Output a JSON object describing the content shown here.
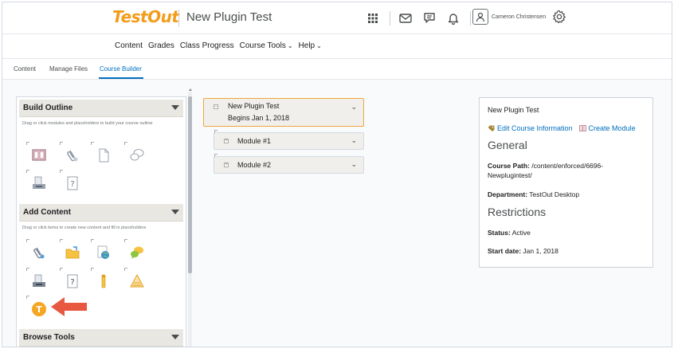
{
  "header": {
    "logo": "TestOut",
    "course_title": "New Plugin Test",
    "user_name": "Cameron Christensen",
    "icons": [
      "grid-icon",
      "mail-icon",
      "chat-icon",
      "bell-icon",
      "user-avatar-icon",
      "gear-icon"
    ]
  },
  "nav": {
    "items": [
      "Content",
      "Grades",
      "Class Progress",
      "Course Tools",
      "Help"
    ]
  },
  "tabs": {
    "items": [
      "Content",
      "Manage Files",
      "Course Builder"
    ],
    "active": "Course Builder"
  },
  "sidebar": {
    "build_outline": {
      "title": "Build Outline",
      "description": "Drag or click modules and placeholders to build your course outline",
      "tools": [
        "module-icon",
        "attachment-placeholder-icon",
        "page-placeholder-icon",
        "discussion-placeholder-icon",
        "dropbox-placeholder-icon",
        "quiz-placeholder-icon"
      ]
    },
    "add_content": {
      "title": "Add Content",
      "description": "Drag or click items to create new content and fill in placeholders",
      "tools": [
        "attachment-icon",
        "folder-icon",
        "web-link-icon",
        "discussion-icon",
        "dropbox-icon",
        "quiz-icon",
        "checklist-icon",
        "survey-icon",
        "testout-plugin-icon"
      ]
    },
    "browse_tools": {
      "title": "Browse Tools"
    }
  },
  "outline": {
    "root": {
      "name": "New Plugin Test",
      "date": "Begins Jan 1, 2018"
    },
    "modules": [
      "Module #1",
      "Module #2"
    ]
  },
  "info": {
    "title": "New Plugin Test",
    "edit_label": "Edit Course Information",
    "create_label": "Create Module",
    "general_heading": "General",
    "course_path_label": "Course Path:",
    "course_path_value": "/content/enforced/6696-Newplugintest/",
    "department_label": "Department:",
    "department_value": "TestOut Desktop",
    "restrictions_heading": "Restrictions",
    "status_label": "Status:",
    "status_value": "Active",
    "start_label": "Start date:",
    "start_value": "Jan 1, 2018"
  },
  "colors": {
    "accent": "#006fbf",
    "brand": "#f39c1a",
    "highlight_arrow": "#e8573f"
  }
}
